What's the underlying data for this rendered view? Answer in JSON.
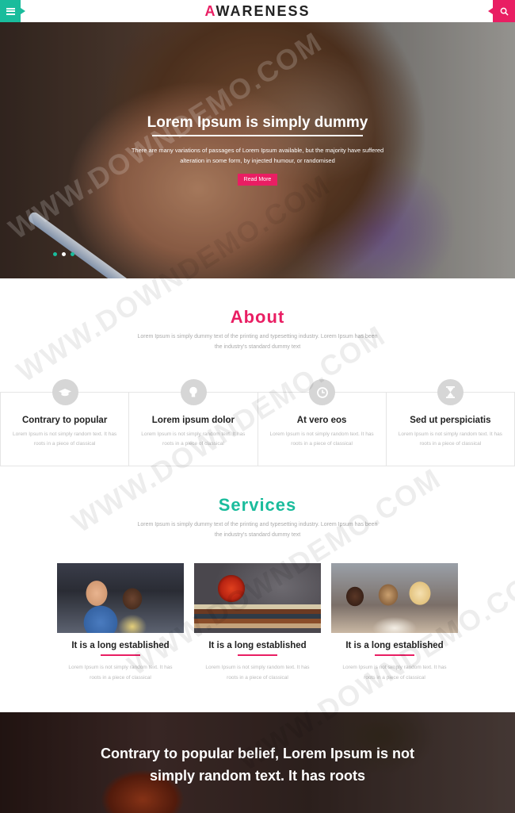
{
  "header": {
    "logo_first": "A",
    "logo_rest": "WARENESS"
  },
  "hero": {
    "title": "Lorem Ipsum is simply dummy",
    "text": "There are many variations of passages of Lorem Ipsum available, but the majority have suffered alteration in some form, by injected humour, or randomised",
    "button": "Read More",
    "slides": 3,
    "active_slide": 2
  },
  "about": {
    "title": "About",
    "subtitle": "Lorem Ipsum is simply dummy text of the printing and typesetting industry. Lorem Ipsum has been the industry's standard dummy text",
    "features": [
      {
        "icon": "graduation-cap-icon",
        "title": "Contrary to popular",
        "text": "Lorem Ipsum is not simply random text. It has roots in a piece of classical"
      },
      {
        "icon": "lightbulb-icon",
        "title": "Lorem ipsum dolor",
        "text": "Lorem Ipsum is not simply random text. It has roots in a piece of classical"
      },
      {
        "icon": "clock-icon",
        "title": "At vero eos",
        "text": "Lorem Ipsum is not simply random text. It has roots in a piece of classical"
      },
      {
        "icon": "hourglass-icon",
        "title": "Sed ut perspiciatis",
        "text": "Lorem Ipsum is not simply random text. It has roots in a piece of classical"
      }
    ]
  },
  "services": {
    "title": "Services",
    "subtitle": "Lorem Ipsum is simply dummy text of the printing and typesetting industry. Lorem Ipsum has been the industry's standard dummy text",
    "items": [
      {
        "title": "It is a long established",
        "text": "Lorem Ipsum is not simply random text. It has roots in a piece of classical"
      },
      {
        "title": "It is a long established",
        "text": "Lorem Ipsum is not simply random text. It has roots in a piece of classical"
      },
      {
        "title": "It is a long established",
        "text": "Lorem Ipsum is not simply random text. It has roots in a piece of classical"
      }
    ]
  },
  "banner": {
    "title": "Contrary to popular belief, Lorem Ipsum is not simply random text. It has roots"
  },
  "watermark": "WWW.DOWNDEMO.COM",
  "colors": {
    "accent_pink": "#e91e63",
    "accent_teal": "#1abc9c"
  }
}
